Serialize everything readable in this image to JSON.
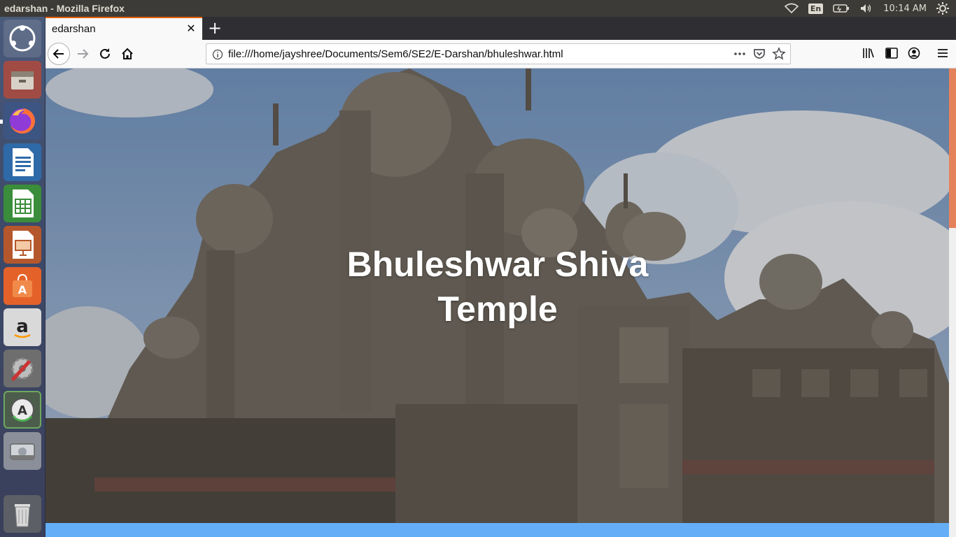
{
  "system": {
    "window_title": "edarshan - Mozilla Firefox",
    "keyboard_layout": "En",
    "clock": "10:14 AM",
    "tray_icons": [
      "wifi-icon",
      "keyboard-icon",
      "battery-icon",
      "volume-icon",
      "settings-icon"
    ]
  },
  "launcher": {
    "items": [
      "ubuntu-dash",
      "files",
      "firefox",
      "libreoffice-writer",
      "libreoffice-calc",
      "libreoffice-impress",
      "ubuntu-software",
      "amazon",
      "system-settings",
      "software-updater",
      "disk-drive",
      "trash"
    ]
  },
  "browser": {
    "tab_title": "edarshan",
    "url": "file:///home/jayshree/Documents/Sem6/SE2/E-Darshan/bhuleshwar.html"
  },
  "page": {
    "hero_title": "Bhuleshwar Shiva Temple"
  },
  "colors": {
    "accent_tab": "#e66000",
    "scroll_thumb": "#e5825b",
    "bottom_bar": "#63aef7"
  }
}
